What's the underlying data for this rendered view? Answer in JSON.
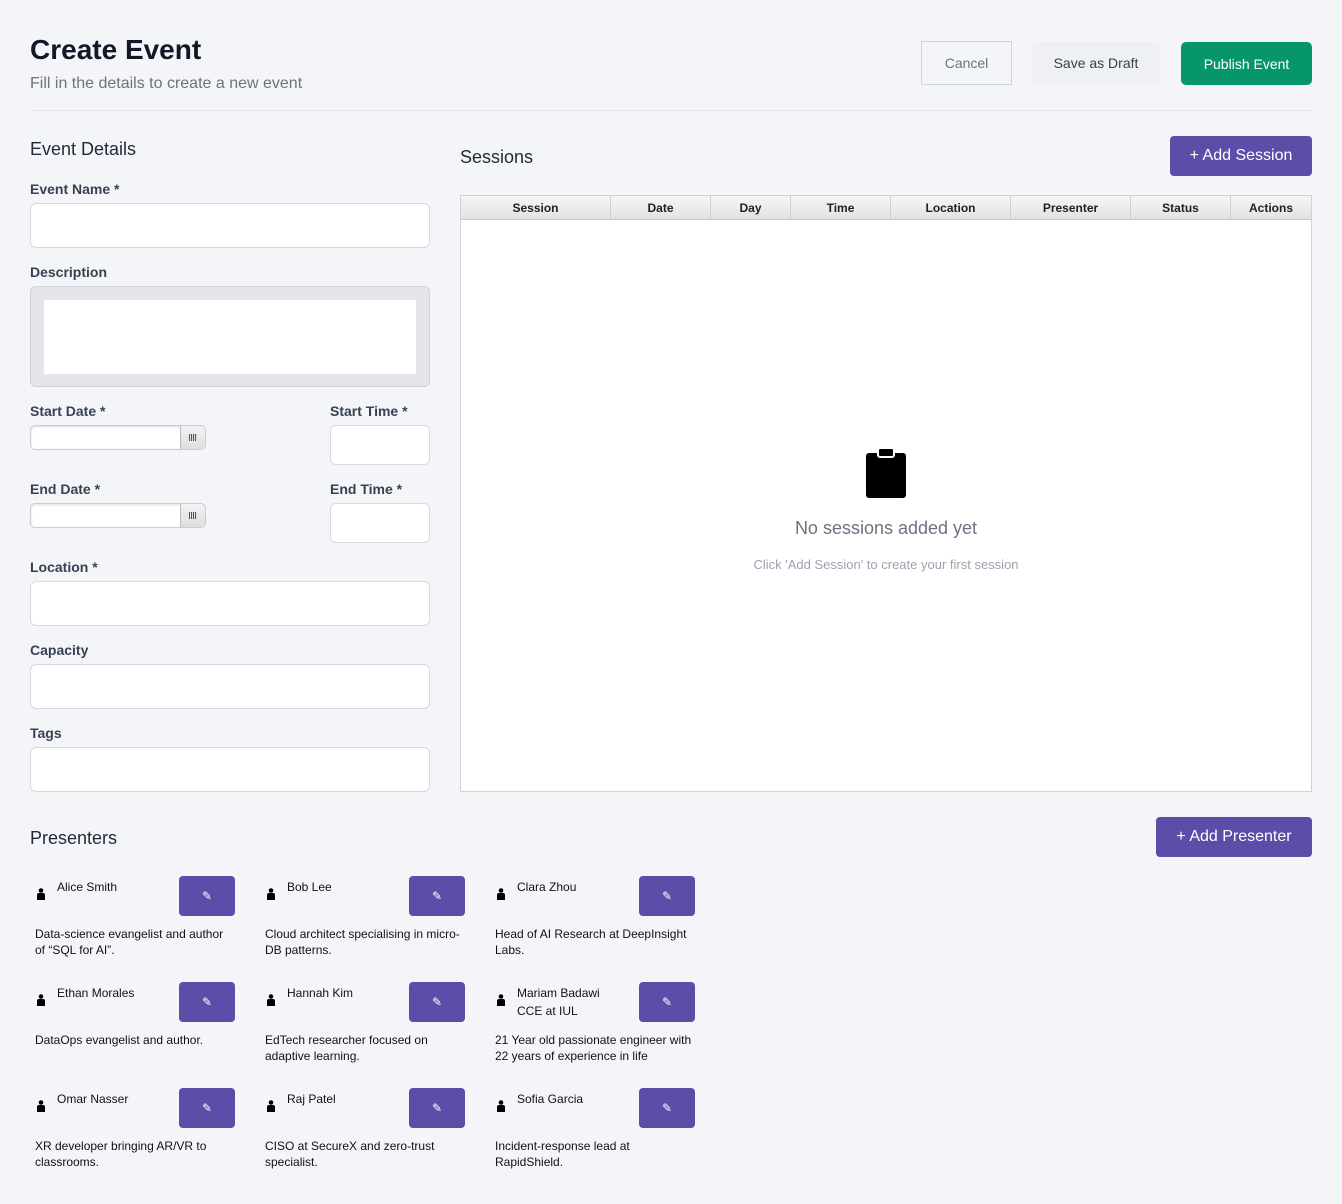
{
  "header": {
    "title": "Create Event",
    "subtitle": "Fill in the details to create a new event",
    "cancel": "Cancel",
    "save_draft": "Save as Draft",
    "publish": "Publish Event"
  },
  "colors": {
    "primary": "#5b4ea8",
    "publish": "#079669"
  },
  "form": {
    "section": "Event Details",
    "event_name": "Event Name *",
    "description": "Description",
    "start_date": "Start Date *",
    "start_time": "Start Time *",
    "end_date": "End Date *",
    "end_time": "End Time *",
    "location": "Location *",
    "capacity": "Capacity",
    "tags": "Tags"
  },
  "sessions": {
    "title": "Sessions",
    "add": "+ Add Session",
    "columns": [
      "Session",
      "Date",
      "Day",
      "Time",
      "Location",
      "Presenter",
      "Status",
      "Actions"
    ],
    "empty_title": "No sessions added yet",
    "empty_sub": "Click 'Add Session' to create your first session"
  },
  "presenters": {
    "title": "Presenters",
    "add": "+ Add Presenter",
    "items": [
      {
        "name": "Alice Smith",
        "bio": "Data-science evangelist and author of “SQL for AI”."
      },
      {
        "name": "Bob Lee",
        "bio": "Cloud architect specialising in micro-DB patterns."
      },
      {
        "name": "Clara Zhou",
        "bio": "Head of AI Research at DeepInsight Labs."
      },
      {
        "name": "Ethan Morales",
        "bio": "DataOps evangelist and author."
      },
      {
        "name": "Hannah Kim",
        "bio": "EdTech researcher focused on adaptive learning."
      },
      {
        "name": "Mariam Badawi\nCCE at IUL",
        "bio": "21 Year old passionate engineer with 22 years of experience in life"
      },
      {
        "name": "Omar Nasser",
        "bio": "XR developer bringing AR/VR to classrooms."
      },
      {
        "name": "Raj Patel",
        "bio": "CISO at SecureX and zero-trust specialist."
      },
      {
        "name": "Sofia Garcia",
        "bio": "Incident-response lead at RapidShield."
      }
    ]
  }
}
